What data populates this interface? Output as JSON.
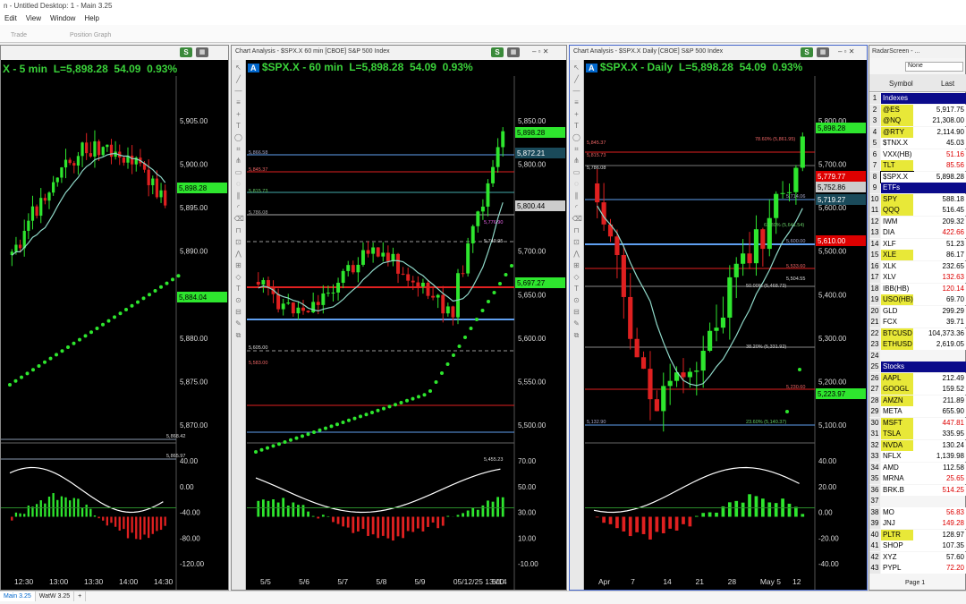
{
  "title": "n - Untitled Desktop: 1 - Main 3.25",
  "menu": [
    "Edit",
    "View",
    "Window",
    "Help"
  ],
  "toolbar": {
    "trade": "Trade",
    "position_graph": "Position Graph"
  },
  "chart1": {
    "header": "",
    "sym_label": "X - 5 min",
    "last": "L=5,898.28",
    "chg": "54.09",
    "pct": "0.93%",
    "price_axis": [
      "5,905.00",
      "5,900.00",
      "5,895.00",
      "5,890.00",
      "5,885.00",
      "5,880.00",
      "5,875.00",
      "5,870.00"
    ],
    "tags": {
      "t1": "5,898.28",
      "t2": "5,884.04",
      "h1": "5,868.42",
      "h2": "5,865.97"
    },
    "osc_axis": [
      "40.00",
      "0.00",
      "-40.00",
      "-80.00",
      "-120.00"
    ],
    "time_axis": [
      "12:30",
      "13:00",
      "13:30",
      "14:00",
      "14:30"
    ],
    "corner": "4/9/8"
  },
  "chart2": {
    "header": "Chart Analysis - $SPX.X 60 min [CBOE] S&P 500 Index",
    "sym_label": "$SPX.X - 60 min",
    "last": "L=5,898.28",
    "chg": "54.09",
    "pct": "0.93%",
    "price_axis": [
      "5,850.00",
      "5,800.00",
      "5,750.00",
      "5,700.00",
      "5,650.00",
      "5,600.00",
      "5,550.00",
      "5,500.00"
    ],
    "tags": {
      "t1": "5,898.28",
      "t2": "5,872.21",
      "t3": "5,800.44",
      "t4": "5,749.95",
      "t5": "5,697.27",
      "t6": "5,455.23"
    },
    "fib": [
      "5,866.58",
      "5,845.37",
      "5,815.73",
      "5,786.08",
      "5,776.90",
      "5,717.77",
      "5,645.15",
      "5,605.00",
      "5,583.00",
      "5,491"
    ],
    "osc_axis": [
      "70.00",
      "50.00",
      "30.00",
      "10.00",
      "-10.00"
    ],
    "time_axis": [
      "5/5",
      "5/6",
      "5/7",
      "5/8",
      "5/9",
      "05/12/25 13:00",
      "5/14"
    ]
  },
  "chart3": {
    "header": "Chart Analysis - $SPX.X Daily [CBOE] S&P 500 Index",
    "sym_label": "$SPX.X - Daily",
    "last": "L=5,898.28",
    "chg": "54.09",
    "pct": "0.93%",
    "price_axis": [
      "5,800.00",
      "5,700.00",
      "5,600.00",
      "5,500.00",
      "5,400.00",
      "5,300.00",
      "5,200.00",
      "5,100.00"
    ],
    "tags": {
      "t1": "5,898.28",
      "t2": "5,779.77",
      "t3": "5,752.86",
      "t4": "5,719.27",
      "t5": "5,610.00",
      "t6": "5,223.97"
    },
    "fib": [
      "5,845.37",
      "5,815.73",
      "5,786.08",
      "78.60% (5,861.95)",
      "5,714.06",
      "61.80% (5,641.54)",
      "5,600.00",
      "5,533.60",
      "5,504.55",
      "50.00% (5,468.73)",
      "38.20% (5,331.92)",
      "5,230.60",
      "5,132.90",
      "23.60% (5,140.37)"
    ],
    "osc_axis": [
      "40.00",
      "20.00",
      "0.00",
      "-20.00",
      "-40.00"
    ],
    "time_axis": [
      "Apr",
      "7",
      "14",
      "21",
      "28",
      "May 5",
      "12"
    ]
  },
  "radar": {
    "header": "RadarScreen - ...",
    "col_symbol": "Symbol",
    "col_last": "Last",
    "none_label": "None",
    "page": "Page 1",
    "rows": [
      {
        "n": "1",
        "s": "Indexes",
        "l": "",
        "sect": true
      },
      {
        "n": "2",
        "s": "@ES",
        "l": "5,917.75",
        "c": "#e8e838"
      },
      {
        "n": "3",
        "s": "@NQ",
        "l": "21,308.00",
        "c": "#e8e838"
      },
      {
        "n": "4",
        "s": "@RTY",
        "l": "2,114.90",
        "c": "#e8e838"
      },
      {
        "n": "5",
        "s": "$TNX.X",
        "l": "45.03",
        "c": "#fff"
      },
      {
        "n": "6",
        "s": "VXX(HB)",
        "l": "51.16",
        "c": "#fff",
        "lc": "#d00"
      },
      {
        "n": "7",
        "s": "TLT",
        "l": "85.56",
        "c": "#e8e838",
        "lc": "#d00"
      },
      {
        "n": "8",
        "s": "$SPX.X",
        "l": "5,898.28",
        "c": "#fff"
      },
      {
        "n": "9",
        "s": "ETFs",
        "l": "",
        "sect": true
      },
      {
        "n": "10",
        "s": "SPY",
        "l": "588.18",
        "c": "#e8e838"
      },
      {
        "n": "11",
        "s": "QQQ",
        "l": "516.45",
        "c": "#e8e838"
      },
      {
        "n": "12",
        "s": "IWM",
        "l": "209.32",
        "c": "#fff"
      },
      {
        "n": "13",
        "s": "DIA",
        "l": "422.66",
        "c": "#fff",
        "lc": "#d00"
      },
      {
        "n": "14",
        "s": "XLF",
        "l": "51.23",
        "c": "#fff"
      },
      {
        "n": "15",
        "s": "XLE",
        "l": "86.17",
        "c": "#e8e838"
      },
      {
        "n": "16",
        "s": "XLK",
        "l": "232.65",
        "c": "#fff"
      },
      {
        "n": "17",
        "s": "XLV",
        "l": "132.63",
        "c": "#fff",
        "lc": "#d00"
      },
      {
        "n": "18",
        "s": "IBB(HB)",
        "l": "120.14",
        "c": "#fff",
        "lc": "#d00"
      },
      {
        "n": "19",
        "s": "USO(HB)",
        "l": "69.70",
        "c": "#e8e838"
      },
      {
        "n": "20",
        "s": "GLD",
        "l": "299.29",
        "c": "#fff"
      },
      {
        "n": "21",
        "s": "FCX",
        "l": "39.71",
        "c": "#fff"
      },
      {
        "n": "22",
        "s": "BTCUSD",
        "l": "104,373.36",
        "c": "#e8e838"
      },
      {
        "n": "23",
        "s": "ETHUSD",
        "l": "2,619.05",
        "c": "#e8e838"
      },
      {
        "n": "24",
        "s": "",
        "l": "",
        "c": "#fff"
      },
      {
        "n": "25",
        "s": "Stocks",
        "l": "",
        "sect": true
      },
      {
        "n": "26",
        "s": "AAPL",
        "l": "212.49",
        "c": "#e8e838"
      },
      {
        "n": "27",
        "s": "GOOGL",
        "l": "159.52",
        "c": "#e8e838"
      },
      {
        "n": "28",
        "s": "AMZN",
        "l": "211.89",
        "c": "#e8e838"
      },
      {
        "n": "29",
        "s": "META",
        "l": "655.90",
        "c": "#fff"
      },
      {
        "n": "30",
        "s": "MSFT",
        "l": "447.81",
        "c": "#e8e838",
        "lc": "#d00"
      },
      {
        "n": "31",
        "s": "TSLA",
        "l": "335.95",
        "c": "#e8e838"
      },
      {
        "n": "32",
        "s": "NVDA",
        "l": "130.24",
        "c": "#e8e838"
      },
      {
        "n": "33",
        "s": "NFLX",
        "l": "1,139.98",
        "c": "#fff"
      },
      {
        "n": "34",
        "s": "AMD",
        "l": "112.58",
        "c": "#fff"
      },
      {
        "n": "35",
        "s": "MRNA",
        "l": "25.65",
        "c": "#fff",
        "lc": "#d00"
      },
      {
        "n": "36",
        "s": "BRK.B",
        "l": "514.25",
        "c": "#fff",
        "lc": "#d00"
      },
      {
        "n": "37",
        "s": "",
        "l": "",
        "c": "#fff"
      },
      {
        "n": "38",
        "s": "MO",
        "l": "56.83",
        "c": "#fff",
        "lc": "#d00"
      },
      {
        "n": "39",
        "s": "JNJ",
        "l": "149.28",
        "c": "#fff",
        "lc": "#d00"
      },
      {
        "n": "40",
        "s": "PLTR",
        "l": "128.97",
        "c": "#e8e838"
      },
      {
        "n": "41",
        "s": "SHOP",
        "l": "107.35",
        "c": "#fff"
      },
      {
        "n": "42",
        "s": "XYZ",
        "l": "57.60",
        "c": "#fff"
      },
      {
        "n": "43",
        "s": "PYPL",
        "l": "72.20",
        "c": "#fff",
        "lc": "#d00"
      }
    ]
  },
  "status_tabs": [
    "Main 3.25",
    "WatW 3.25",
    "+"
  ],
  "colors": {
    "up": "#2ee62e",
    "down": "#e02020",
    "accent": "#0b0b8a",
    "bg": "#000000"
  }
}
